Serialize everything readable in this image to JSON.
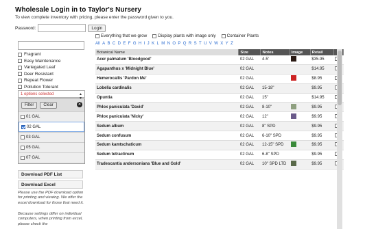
{
  "header": {
    "title": "Wholesale Login in to Taylor's Nursery",
    "subtitle": "To view complete inventory with pricing, please enter the password given to you.",
    "password_label": "Password:",
    "login_label": "Login"
  },
  "sidebar": {
    "search_value": "",
    "checkboxes": [
      {
        "label": "Fragrant",
        "checked": false
      },
      {
        "label": "Easy Maintenance",
        "checked": false
      },
      {
        "label": "Variegated Leaf",
        "checked": false
      },
      {
        "label": "Deer Resistant",
        "checked": false
      },
      {
        "label": "Repeat Flower",
        "checked": false
      },
      {
        "label": "Pollution Tolerant",
        "checked": false
      }
    ],
    "size_select_text": "1 options selected",
    "dropdown": {
      "filter_label": "Filter",
      "clear_label": "Clear",
      "close_glyph": "✕",
      "options": [
        {
          "label": "01 GAL",
          "checked": false
        },
        {
          "label": "02 GAL",
          "checked": true
        },
        {
          "label": "03 GAL",
          "checked": false
        },
        {
          "label": "05 GAL",
          "checked": false
        },
        {
          "label": "07 GAL",
          "checked": false
        }
      ]
    },
    "pdf_button": "Download PDF List",
    "excel_button": "Download Excel",
    "note1": "Please use the PDF download option for printing and viewing. We offer the excel download for those that need it.",
    "note2": "Because settings differ on individual computers, when printing from excel, please check the"
  },
  "filters": {
    "everything": "Everything that we grow",
    "with_image": "Display plants with image only",
    "container": "Container Plants"
  },
  "alphabet": [
    "All",
    "A",
    "B",
    "C",
    "D",
    "E",
    "F",
    "G",
    "H",
    "I",
    "J",
    "K",
    "L",
    "M",
    "N",
    "O",
    "P",
    "Q",
    "R",
    "S",
    "T",
    "U",
    "V",
    "W",
    "X",
    "Y",
    "Z"
  ],
  "table": {
    "columns": [
      "Botanical Name",
      "Size",
      "Notes",
      "Image",
      "Retail",
      ""
    ],
    "rows": [
      {
        "name": "Acer palmatum 'Bloodgood'",
        "size": "02 GAL",
        "notes": "4-5'",
        "image": "dark-leaf",
        "retail": "$35.95"
      },
      {
        "name": "Agapanthus x 'Midnight Blue'",
        "size": "02 GAL",
        "notes": "",
        "image": "",
        "retail": "$14.95"
      },
      {
        "name": "Hemerocallis 'Pardon Me'",
        "size": "02 GAL",
        "notes": "",
        "image": "red-flower",
        "retail": "$8.95"
      },
      {
        "name": "Lobelia cardinalis",
        "size": "02 GAL",
        "notes": "15-18\"",
        "image": "",
        "retail": "$9.95"
      },
      {
        "name": "Opuntia",
        "size": "02 GAL",
        "notes": "15\"",
        "image": "",
        "retail": "$14.95"
      },
      {
        "name": "Phlox paniculata 'David'",
        "size": "02 GAL",
        "notes": "8-10\"",
        "image": "white-flower",
        "retail": "$9.95"
      },
      {
        "name": "Phlox paniculata 'Nicky'",
        "size": "02 GAL",
        "notes": "12\"",
        "image": "purple-flower",
        "retail": "$9.95"
      },
      {
        "name": "Sedum album",
        "size": "02 GAL",
        "notes": "8\" SPD",
        "image": "",
        "retail": "$9.95"
      },
      {
        "name": "Sedum confusum",
        "size": "02 GAL",
        "notes": "6-10\" SPD",
        "image": "",
        "retail": "$9.95"
      },
      {
        "name": "Sedum kamtschaticum",
        "size": "02 GAL",
        "notes": "12-15\" SPD",
        "image": "green-plant",
        "retail": "$9.95"
      },
      {
        "name": "Sedum tetractinum",
        "size": "02 GAL",
        "notes": "6-8\" SPD",
        "image": "",
        "retail": "$9.95"
      },
      {
        "name": "Tradescantia andersoniana 'Blue and Gold'",
        "size": "02 GAL",
        "notes": "10\" SPD LTD",
        "image": "plant-photo",
        "retail": "$9.95"
      }
    ]
  }
}
